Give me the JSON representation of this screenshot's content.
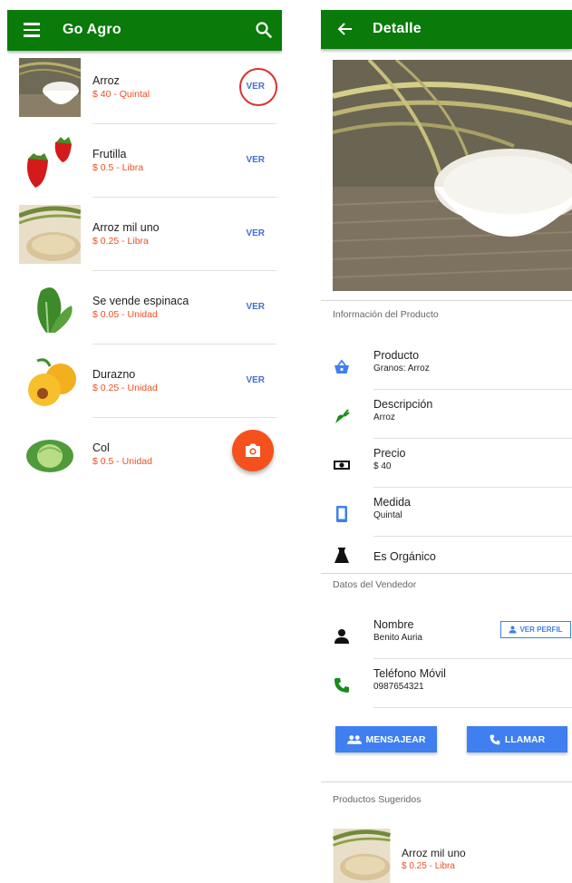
{
  "colors": {
    "appbar": "#0a7a0a",
    "accent_blue": "#3f7ff0",
    "price": "#ef4f1f",
    "fab": "#f4511e",
    "highlight_ring": "#d8332f"
  },
  "list_screen": {
    "title": "Go Agro",
    "icons": {
      "menu": "menu-icon",
      "search": "search-icon",
      "fab": "camera-icon"
    },
    "products": [
      {
        "name": "Arroz",
        "price": "$ 40 - Quintal",
        "action": "VER",
        "image": "rice-bowl"
      },
      {
        "name": "Frutilla",
        "price": "$ 0.5 - Libra",
        "action": "VER",
        "image": "strawberries"
      },
      {
        "name": "Arroz mil uno",
        "price": "$ 0.25 - Libra",
        "action": "VER",
        "image": "rice-grain"
      },
      {
        "name": "Se vende espinaca",
        "price": "$ 0.05 - Unidad",
        "action": "VER",
        "image": "spinach"
      },
      {
        "name": "Durazno",
        "price": "$ 0.25 - Unidad",
        "action": "VER",
        "image": "peaches"
      },
      {
        "name": "Col",
        "price": "$ 0.5 - Unidad",
        "action": "",
        "image": "cabbage"
      }
    ]
  },
  "detail_screen": {
    "title": "Detalle",
    "product_section": {
      "label": "Información del Producto",
      "rows": [
        {
          "title": "Producto",
          "value": "Granos: Arroz",
          "icon": "basket-icon"
        },
        {
          "title": "Descripción",
          "value": "Arroz",
          "icon": "carrot-icon"
        },
        {
          "title": "Precio",
          "value": "$ 40",
          "icon": "money-icon"
        },
        {
          "title": "Medida",
          "value": "Quintal",
          "icon": "tablet-icon"
        },
        {
          "title": "Es Orgánico",
          "value": "",
          "icon": "flask-icon"
        }
      ]
    },
    "seller_section": {
      "label": "Datos del Vendedor",
      "rows": [
        {
          "title": "Nombre",
          "value": "Benito Auria",
          "icon": "person-icon"
        },
        {
          "title": "Teléfono Móvil",
          "value": "0987654321",
          "icon": "phone-icon"
        }
      ],
      "profile_button": "VER PERFIL",
      "message_button": "MENSAJEAR",
      "call_button": "LLAMAR"
    },
    "suggested": {
      "label": "Productos Sugeridos",
      "items": [
        {
          "name": "Arroz mil uno",
          "price": "$ 0.25 - Libra",
          "image": "rice-grain"
        }
      ]
    }
  }
}
